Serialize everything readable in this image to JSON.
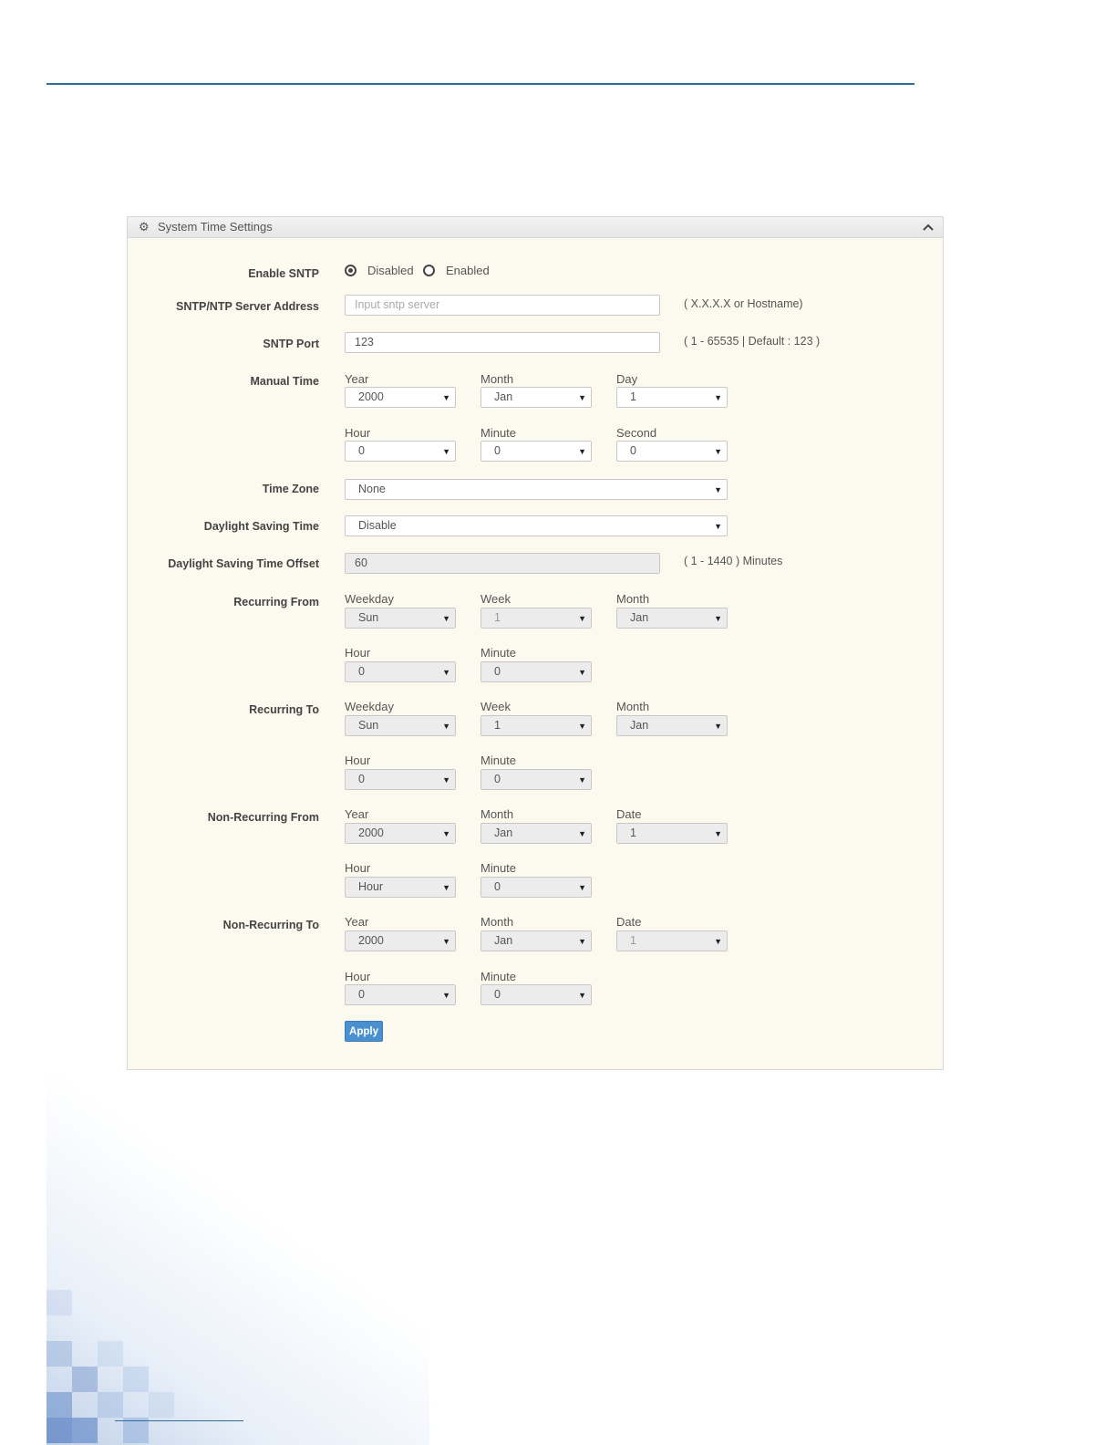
{
  "panel": {
    "title": "System Time Settings"
  },
  "enable_sntp": {
    "label": "Enable SNTP",
    "options": [
      "Disabled",
      "Enabled"
    ],
    "selected": "Disabled"
  },
  "server_address": {
    "label": "SNTP/NTP Server Address",
    "placeholder": "Input sntp server",
    "hint": "( X.X.X.X or Hostname)"
  },
  "sntp_port": {
    "label": "SNTP Port",
    "value": "123",
    "hint": "( 1 - 65535 | Default : 123 )"
  },
  "manual_time": {
    "label": "Manual Time",
    "year": {
      "label": "Year",
      "value": "2000"
    },
    "month": {
      "label": "Month",
      "value": "Jan"
    },
    "day": {
      "label": "Day",
      "value": "1"
    },
    "hour": {
      "label": "Hour",
      "value": "0"
    },
    "minute": {
      "label": "Minute",
      "value": "0"
    },
    "second": {
      "label": "Second",
      "value": "0"
    }
  },
  "time_zone": {
    "label": "Time Zone",
    "value": "None"
  },
  "dst": {
    "label": "Daylight Saving Time",
    "value": "Disable"
  },
  "dst_offset": {
    "label": "Daylight Saving Time Offset",
    "value": "60",
    "hint": "( 1 - 1440 ) Minutes"
  },
  "recurring_from": {
    "label": "Recurring From",
    "weekday": {
      "label": "Weekday",
      "value": "Sun"
    },
    "week": {
      "label": "Week",
      "value": "1"
    },
    "month": {
      "label": "Month",
      "value": "Jan"
    },
    "hour": {
      "label": "Hour",
      "value": "0"
    },
    "minute": {
      "label": "Minute",
      "value": "0"
    }
  },
  "recurring_to": {
    "label": "Recurring To",
    "weekday": {
      "label": "Weekday",
      "value": "Sun"
    },
    "week": {
      "label": "Week",
      "value": "1"
    },
    "month": {
      "label": "Month",
      "value": "Jan"
    },
    "hour": {
      "label": "Hour",
      "value": "0"
    },
    "minute": {
      "label": "Minute",
      "value": "0"
    }
  },
  "non_recurring_from": {
    "label": "Non-Recurring From",
    "year": {
      "label": "Year",
      "value": "2000"
    },
    "month": {
      "label": "Month",
      "value": "Jan"
    },
    "date": {
      "label": "Date",
      "value": "1"
    },
    "hour": {
      "label": "Hour",
      "value": "Hour"
    },
    "minute": {
      "label": "Minute",
      "value": "0"
    }
  },
  "non_recurring_to": {
    "label": "Non-Recurring To",
    "year": {
      "label": "Year",
      "value": "2000"
    },
    "month": {
      "label": "Month",
      "value": "Jan"
    },
    "date": {
      "label": "Date",
      "value": "1"
    },
    "hour": {
      "label": "Hour",
      "value": "0"
    },
    "minute": {
      "label": "Minute",
      "value": "0"
    }
  },
  "apply_label": "Apply",
  "icons": {
    "header": "gear-icon",
    "collapse": "chevron-up-icon",
    "select": "caret-down-icon"
  },
  "colors": {
    "accent": "#2f6d9a",
    "panel_bg": "#fcfaee",
    "button": "#4a90d0"
  }
}
